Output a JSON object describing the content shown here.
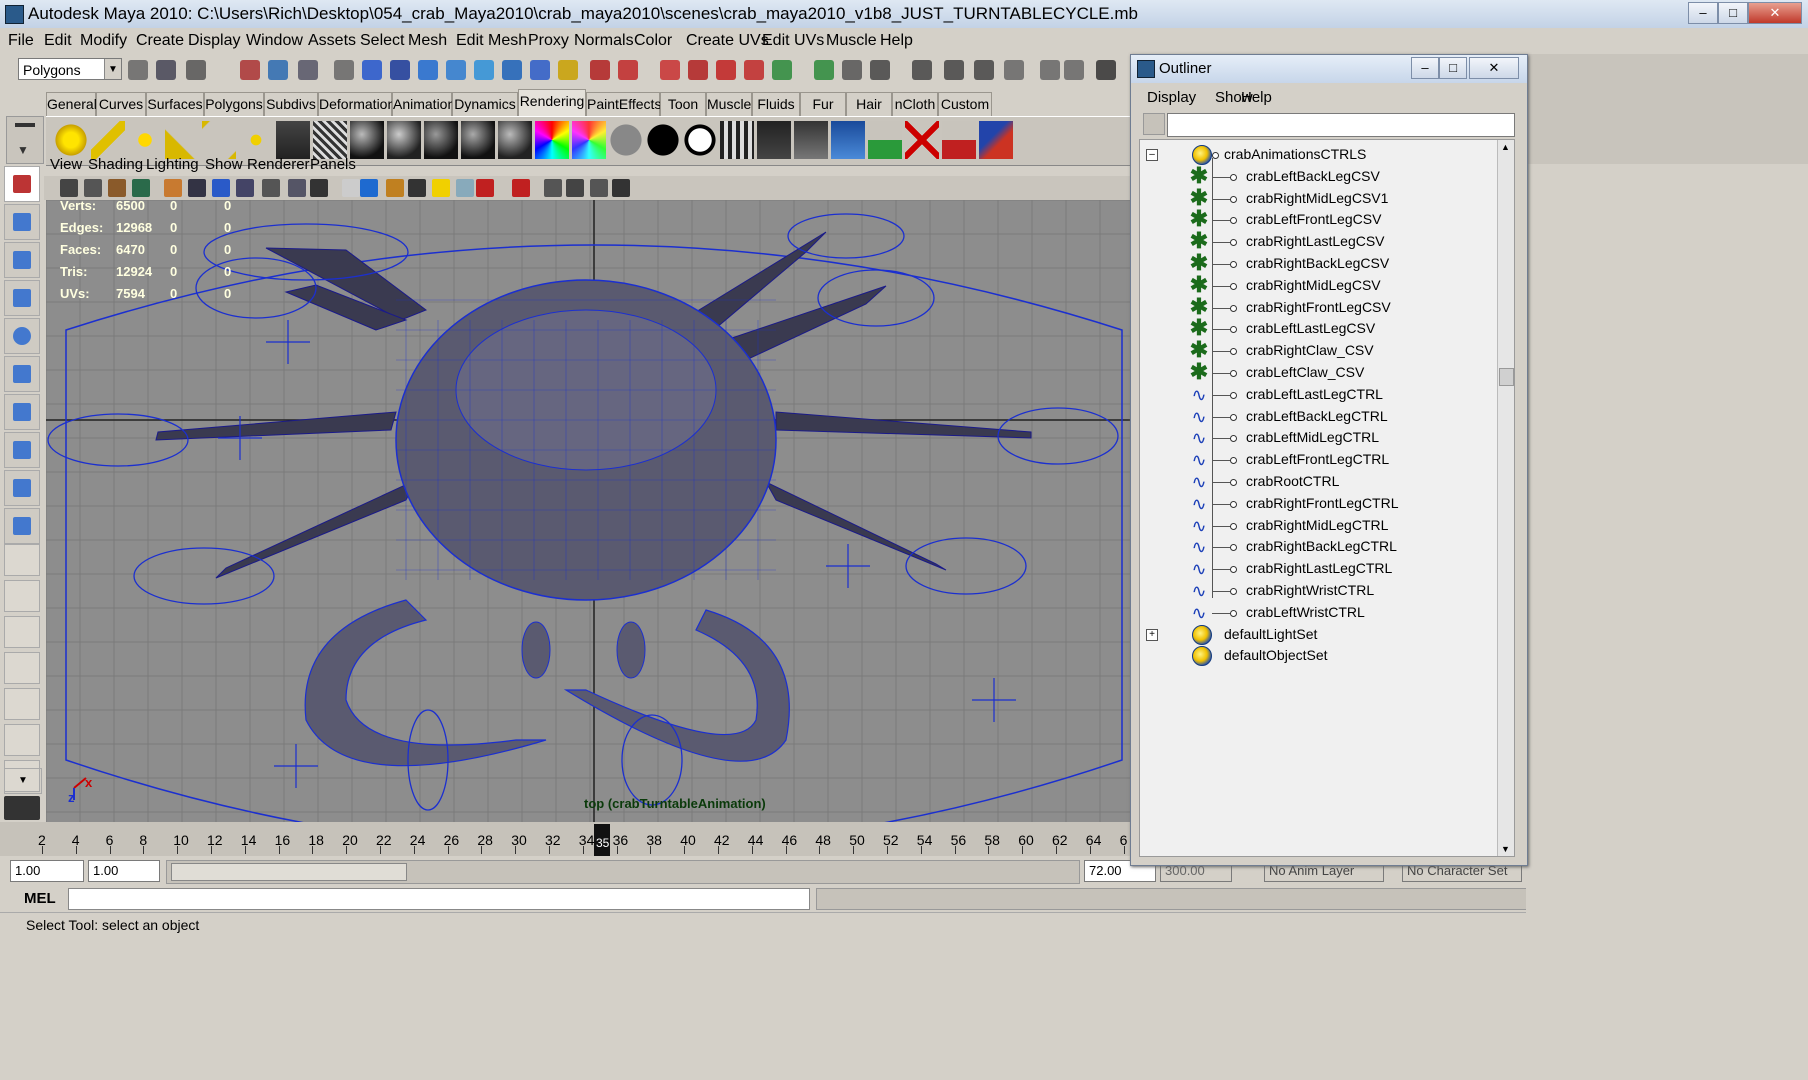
{
  "window": {
    "title": "Autodesk Maya 2010: C:\\Users\\Rich\\Desktop\\054_crab_Maya2010\\crab_maya2010\\scenes\\crab_maya2010_v1b8_JUST_TURNTABLECYCLE.mb",
    "min": "–",
    "max": "□",
    "close": "✕"
  },
  "menubar": [
    "File",
    "Edit",
    "Modify",
    "Create",
    "Display",
    "Window",
    "Assets",
    "Select",
    "Mesh",
    "Edit Mesh",
    "Proxy",
    "Normals",
    "Color",
    "Create UVs",
    "Edit UVs",
    "Muscle",
    "Help"
  ],
  "status": {
    "menuset": "Polygons"
  },
  "shelf": {
    "tabs": [
      "General",
      "Curves",
      "Surfaces",
      "Polygons",
      "Subdivs",
      "Deformation",
      "Animation",
      "Dynamics",
      "Rendering",
      "PaintEffects",
      "Toon",
      "Muscle",
      "Fluids",
      "Fur",
      "Hair",
      "nCloth",
      "Custom"
    ],
    "active_tab": "Rendering"
  },
  "panel_menu": [
    "View",
    "Shading",
    "Lighting",
    "Show",
    "Renderer",
    "Panels"
  ],
  "hud": {
    "rows": [
      {
        "label": "Verts:",
        "v1": "6500",
        "v2": "0",
        "v3": "0"
      },
      {
        "label": "Edges:",
        "v1": "12968",
        "v2": "0",
        "v3": "0"
      },
      {
        "label": "Faces:",
        "v1": "6470",
        "v2": "0",
        "v3": "0"
      },
      {
        "label": "Tris:",
        "v1": "12924",
        "v2": "0",
        "v3": "0"
      },
      {
        "label": "UVs:",
        "v1": "7594",
        "v2": "0",
        "v3": "0"
      }
    ]
  },
  "viewport": {
    "camera_label": "top (crabTurntableAnimation)",
    "axis_x": "x",
    "axis_z": "z"
  },
  "timeline": {
    "ticks": [
      "2",
      "4",
      "6",
      "8",
      "10",
      "12",
      "14",
      "16",
      "18",
      "20",
      "22",
      "24",
      "26",
      "28",
      "30",
      "32",
      "34",
      "36",
      "38",
      "40",
      "42",
      "44",
      "46",
      "48",
      "50",
      "52",
      "54",
      "56",
      "58",
      "60",
      "62",
      "64",
      "6"
    ],
    "current_frame": "35"
  },
  "range": {
    "start": "1.00",
    "playback_start": "1.00",
    "playback_end": "72.00",
    "end": "300.00",
    "anim_layer": "No Anim Layer",
    "character_set": "No Character Set"
  },
  "command": {
    "mel_label": "MEL"
  },
  "helpline": "Select Tool: select an object",
  "outliner": {
    "title": "Outliner",
    "menu": [
      "Display",
      "Show",
      "Help"
    ],
    "rows": [
      {
        "label": "crabAnimationsCTRLS",
        "type": "set",
        "level": 0,
        "expand": "–"
      },
      {
        "label": "crabLeftBackLegCSV",
        "type": "joint",
        "level": 1
      },
      {
        "label": "crabRightMidLegCSV1",
        "type": "joint",
        "level": 1
      },
      {
        "label": "crabLeftFrontLegCSV",
        "type": "joint",
        "level": 1
      },
      {
        "label": "crabRightLastLegCSV",
        "type": "joint",
        "level": 1
      },
      {
        "label": "crabRightBackLegCSV",
        "type": "joint",
        "level": 1
      },
      {
        "label": "crabRightMidLegCSV",
        "type": "joint",
        "level": 1
      },
      {
        "label": "crabRightFrontLegCSV",
        "type": "joint",
        "level": 1
      },
      {
        "label": "crabLeftLastLegCSV",
        "type": "joint",
        "level": 1
      },
      {
        "label": "crabRightClaw_CSV",
        "type": "joint",
        "level": 1
      },
      {
        "label": "crabLeftClaw_CSV",
        "type": "joint",
        "level": 1
      },
      {
        "label": "crabLeftLastLegCTRL",
        "type": "curve",
        "level": 1
      },
      {
        "label": "crabLeftBackLegCTRL",
        "type": "curve",
        "level": 1
      },
      {
        "label": "crabLeftMidLegCTRL",
        "type": "curve",
        "level": 1
      },
      {
        "label": "crabLeftFrontLegCTRL",
        "type": "curve",
        "level": 1
      },
      {
        "label": "crabRootCTRL",
        "type": "curve",
        "level": 1
      },
      {
        "label": "crabRightFrontLegCTRL",
        "type": "curve",
        "level": 1
      },
      {
        "label": "crabRightMidLegCTRL",
        "type": "curve",
        "level": 1
      },
      {
        "label": "crabRightBackLegCTRL",
        "type": "curve",
        "level": 1
      },
      {
        "label": "crabRightLastLegCTRL",
        "type": "curve",
        "level": 1
      },
      {
        "label": "crabRightWristCTRL",
        "type": "curve",
        "level": 1
      },
      {
        "label": "crabLeftWristCTRL",
        "type": "curve",
        "level": 1
      },
      {
        "label": "defaultLightSet",
        "type": "set",
        "level": 0,
        "expand": "+"
      },
      {
        "label": "defaultObjectSet",
        "type": "set",
        "level": 0
      }
    ]
  },
  "colors": {
    "viewport_bg": "#8d8d8d",
    "curve_blue": "#1b2fd0",
    "joint_green": "#1b6b1b",
    "ui_gray": "#d4d0c8"
  }
}
